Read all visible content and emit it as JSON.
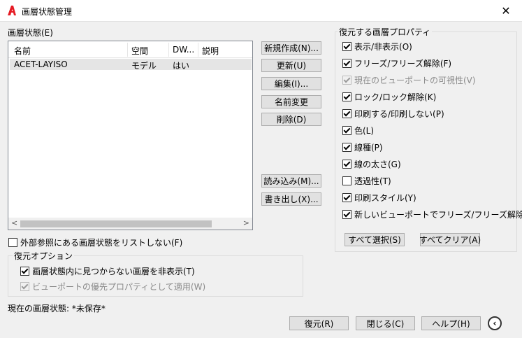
{
  "window": {
    "title": "画層状態管理",
    "close_glyph": "✕",
    "app_icon": "autocad-a-icon"
  },
  "states": {
    "label": "画層状態(E)",
    "columns": [
      "名前",
      "空間",
      "DW...",
      "説明"
    ],
    "rows": [
      {
        "name": "ACET-LAYISO",
        "space": "モデル",
        "dw": "はい",
        "desc": ""
      }
    ]
  },
  "side_buttons": {
    "new": "新規作成(N)...",
    "update": "更新(U)",
    "edit": "編集(I)...",
    "rename": "名前変更",
    "delete": "削除(D)",
    "import": "読み込み(M)...",
    "export": "書き出し(X)..."
  },
  "xref_checkbox": {
    "label": "外部参照にある画層状態をリストしない(F)",
    "checked": false
  },
  "restore_options": {
    "title": "復元オプション",
    "hide_not_found": {
      "label": "画層状態内に見つからない画層を非表示(T)",
      "checked": true
    },
    "apply_viewport": {
      "label": "ビューポートの優先プロパティとして適用(W)",
      "checked": true,
      "disabled": true
    }
  },
  "current_state": "現在の画層状態: *未保存*",
  "properties": {
    "title": "復元する画層プロパティ",
    "items": [
      {
        "label": "表示/非表示(O)",
        "checked": true,
        "disabled": false
      },
      {
        "label": "フリーズ/フリーズ解除(F)",
        "checked": true,
        "disabled": false
      },
      {
        "label": "現在のビューポートの可視性(V)",
        "checked": true,
        "disabled": true
      },
      {
        "label": "ロック/ロック解除(K)",
        "checked": true,
        "disabled": false
      },
      {
        "label": "印刷する/印刷しない(P)",
        "checked": true,
        "disabled": false
      },
      {
        "label": "色(L)",
        "checked": true,
        "disabled": false
      },
      {
        "label": "線種(P)",
        "checked": true,
        "disabled": false
      },
      {
        "label": "線の太さ(G)",
        "checked": true,
        "disabled": false
      },
      {
        "label": "透過性(T)",
        "checked": false,
        "disabled": false
      },
      {
        "label": "印刷スタイル(Y)",
        "checked": true,
        "disabled": false
      },
      {
        "label": "新しいビューポートでフリーズ/フリーズ解除(Z)",
        "checked": true,
        "disabled": false
      }
    ],
    "select_all": "すべて選択(S)",
    "clear_all": "すべてクリア(A)"
  },
  "bottom_buttons": {
    "restore": "復元(R)",
    "close": "閉じる(C)",
    "help": "ヘルプ(H)",
    "collapse": "‹"
  }
}
